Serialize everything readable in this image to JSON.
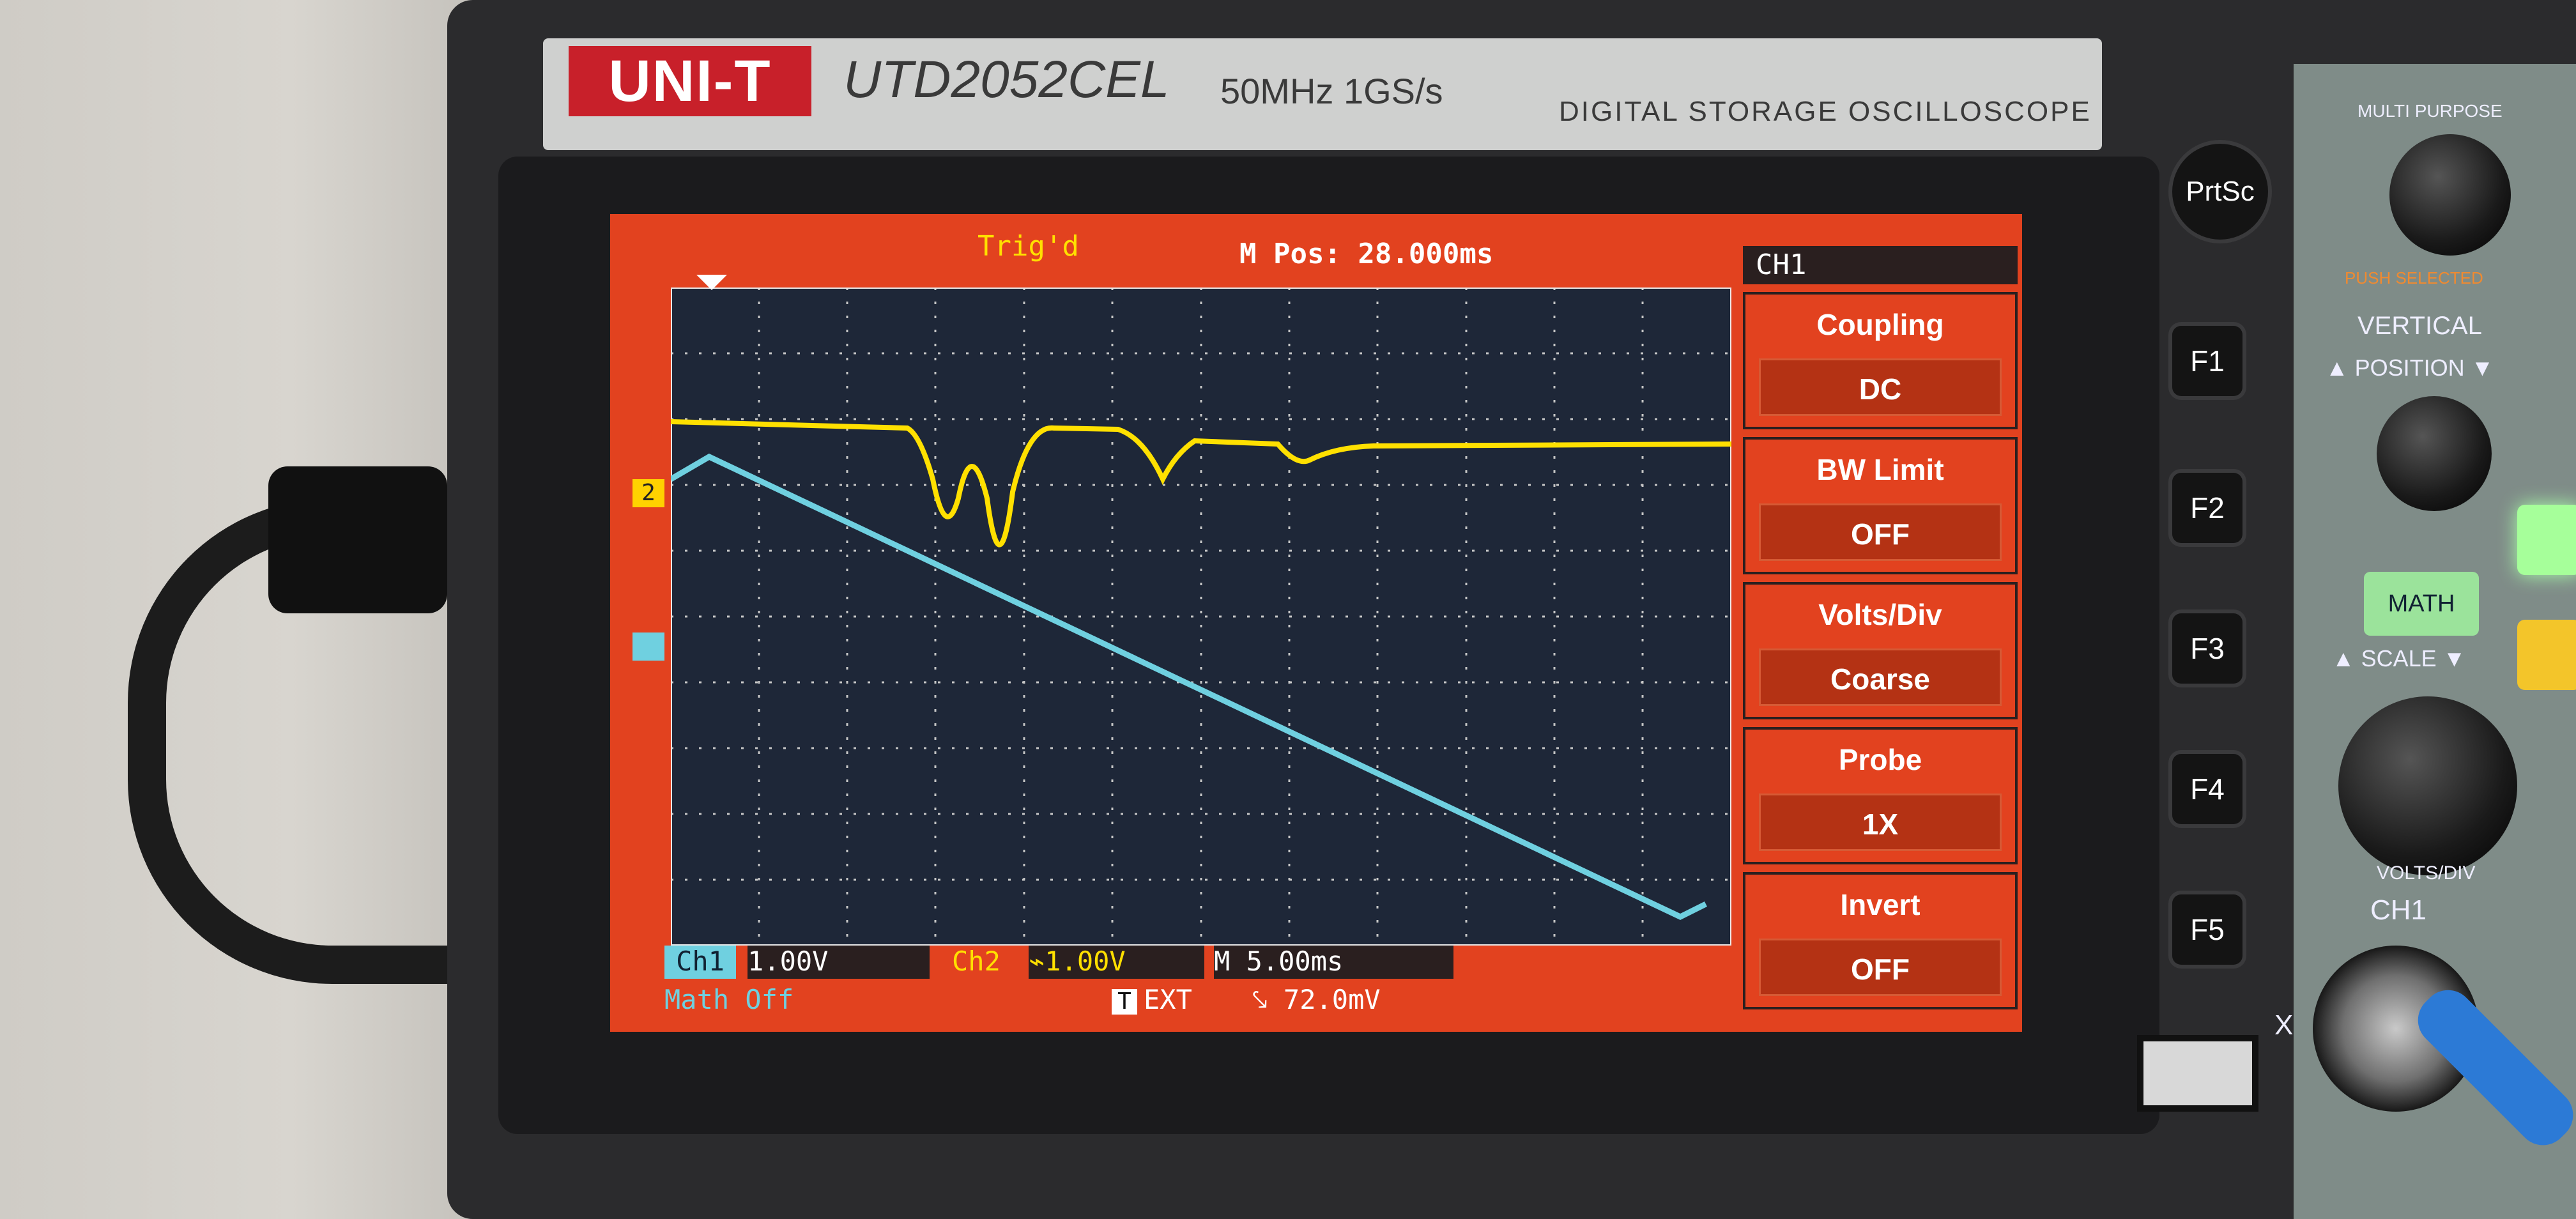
{
  "device": {
    "brand": "UNI-T",
    "model": "UTD2052CEL",
    "specs": "50MHz  1GS/s",
    "description": "DIGITAL STORAGE OSCILLOSCOPE"
  },
  "screen": {
    "trigger_status": "Trig'd",
    "m_pos": "M Pos: 28.000ms",
    "bottom": {
      "ch1_label": "Ch1",
      "ch1_scale": "1.00V",
      "ch2_label": "Ch2",
      "ch2_scale": "⌁1.00V",
      "timebase": "M 5.00ms",
      "math": "Math Off",
      "trigger_source": "EXT",
      "trigger_icon": "T",
      "trigger_level": "⤥  72.0mV"
    },
    "menu": {
      "title": "CH1",
      "items": [
        {
          "title": "Coupling",
          "value": "DC"
        },
        {
          "title": "BW Limit",
          "value": "OFF"
        },
        {
          "title": "Volts/Div",
          "value": "Coarse"
        },
        {
          "title": "Probe",
          "value": "1X"
        },
        {
          "title": "Invert",
          "value": "OFF"
        }
      ]
    },
    "markers": {
      "ch2": "2",
      "ch1": ""
    }
  },
  "buttons": {
    "prtsc": "PrtSc",
    "f1": "F1",
    "f2": "F2",
    "f3": "F3",
    "f4": "F4",
    "f5": "F5"
  },
  "panel": {
    "multi_purpose": "MULTI PURPOSE",
    "push_selected": "PUSH SELECTED",
    "vertical": "VERTICAL",
    "position": "▲ POSITION ▼",
    "math": "MATH",
    "scale": "▲ SCALE ▼",
    "volts_div": "VOLTS/DIV",
    "ch1": "CH1",
    "x": "X"
  },
  "colors": {
    "screen_bg": "#e2421f",
    "grid_bg": "#1e2738",
    "ch1": "#6fd0e0",
    "ch2": "#ffe000"
  }
}
